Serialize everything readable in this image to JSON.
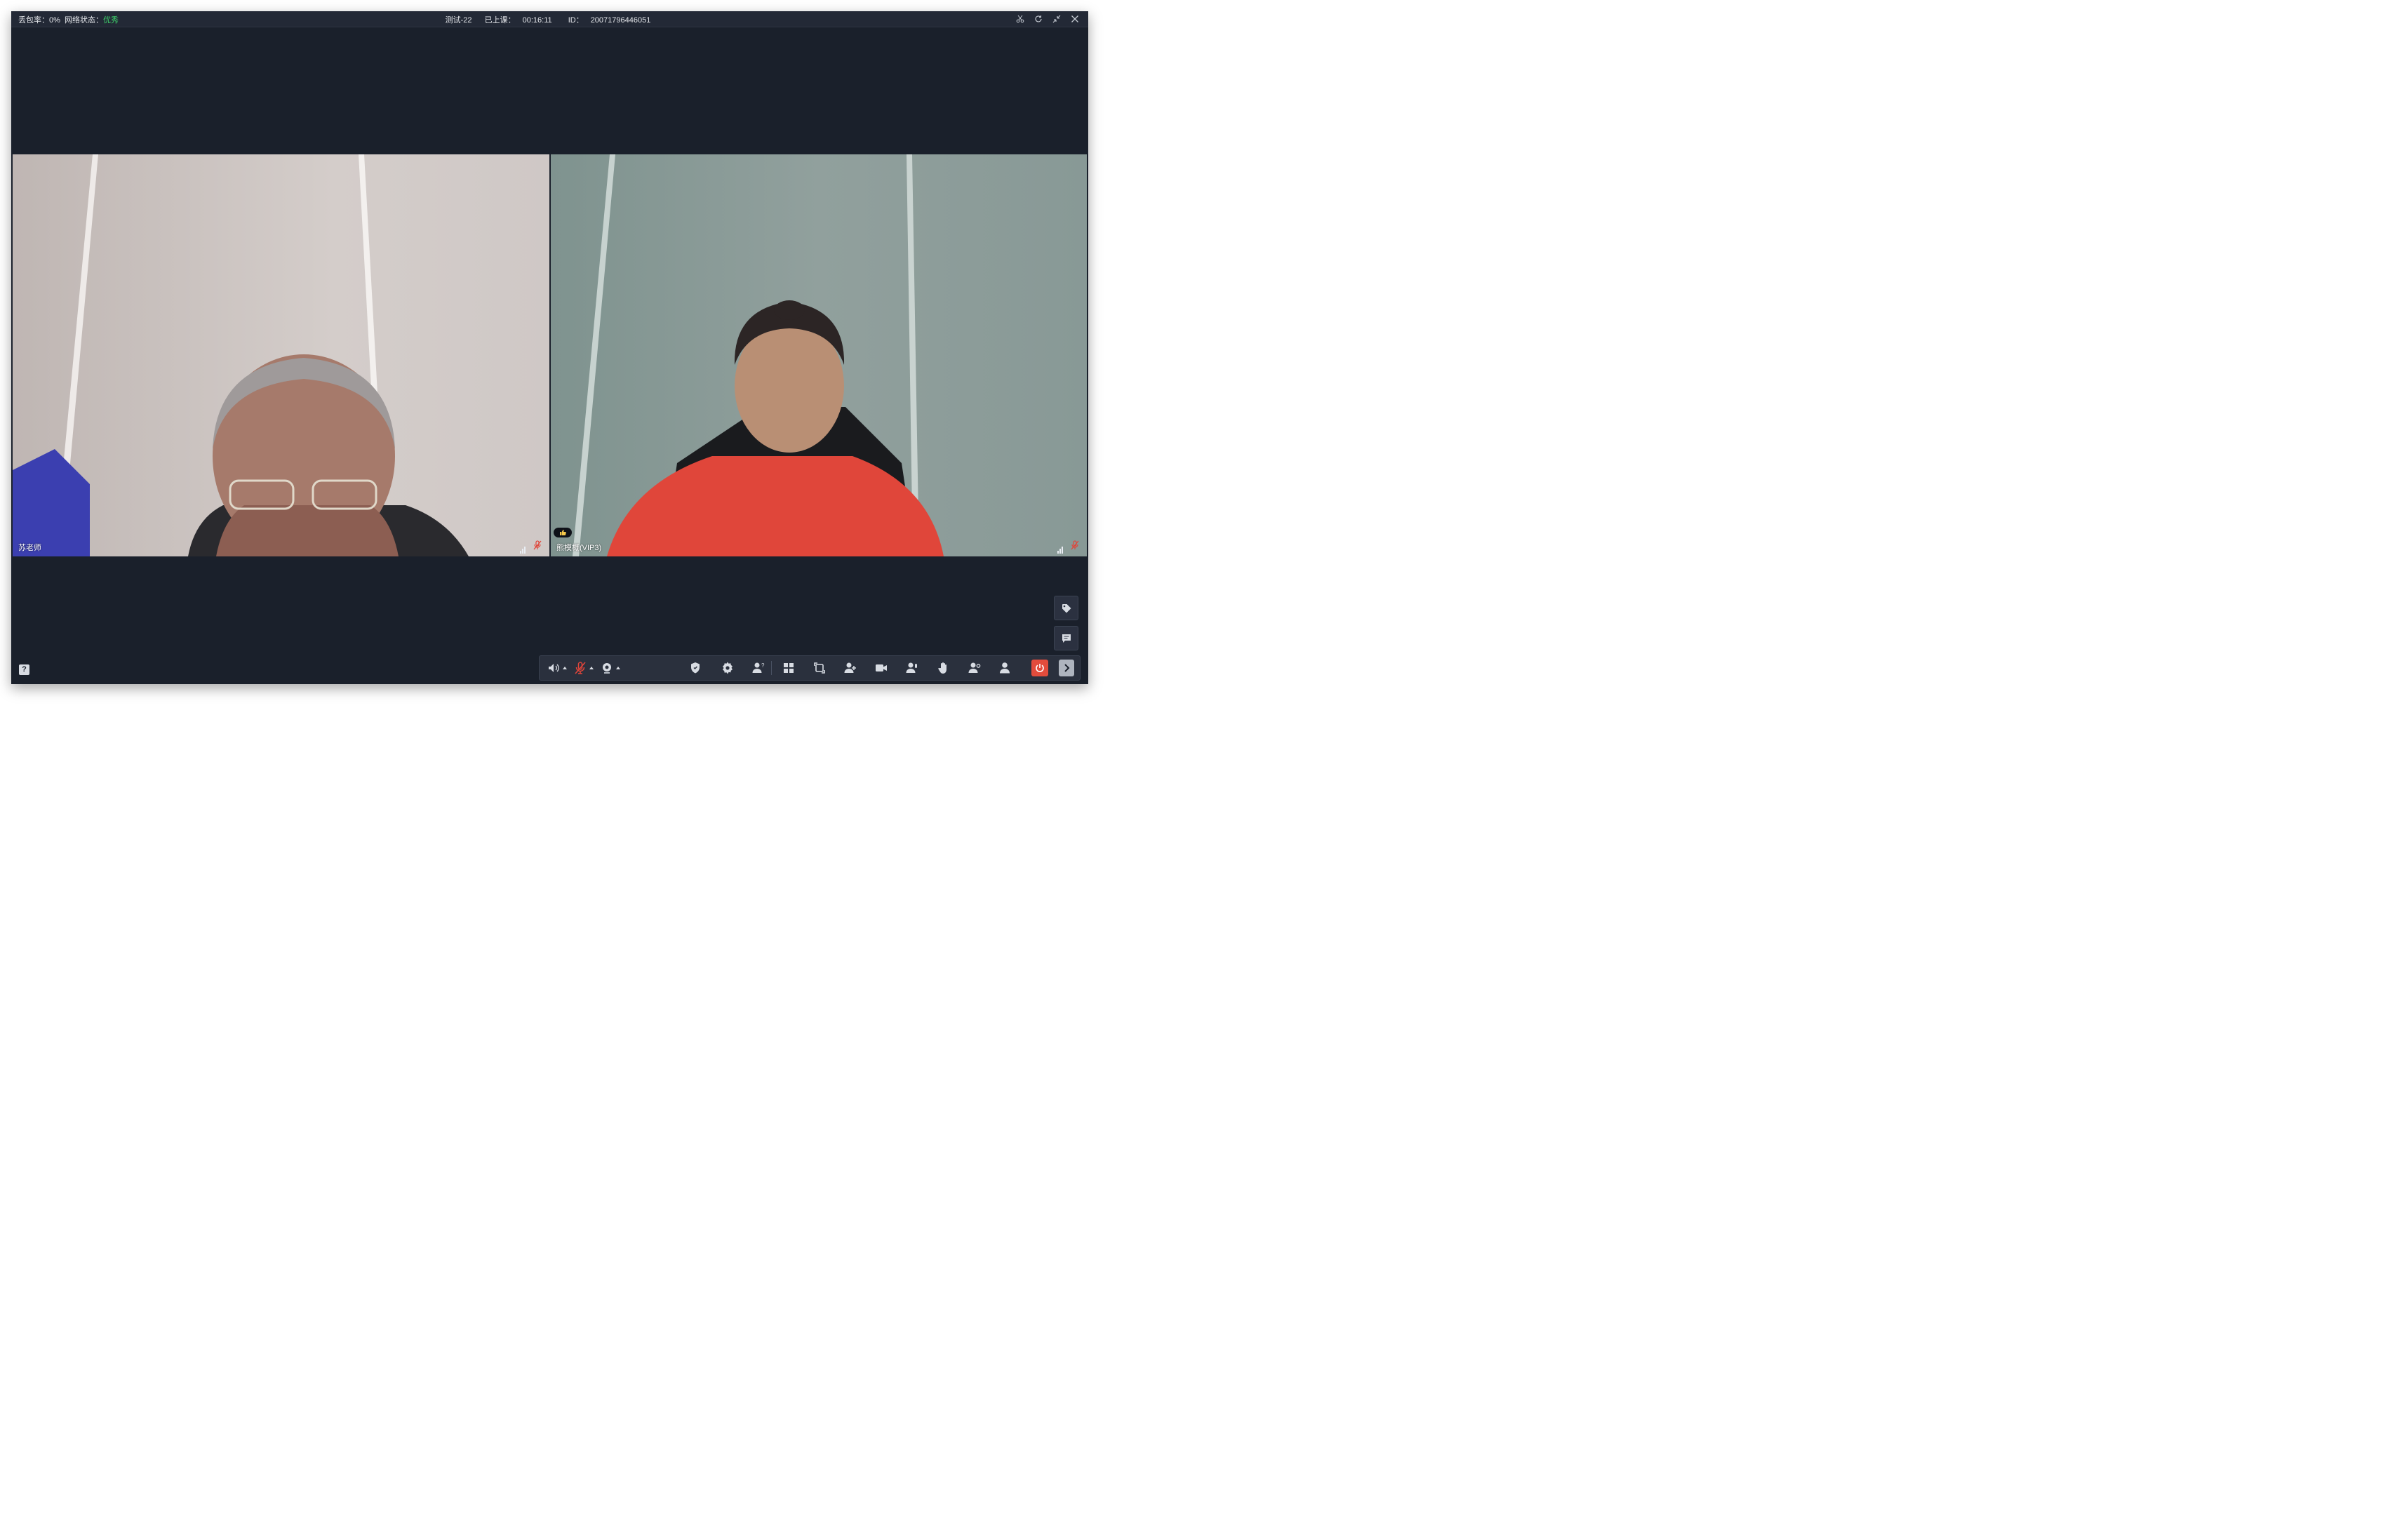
{
  "titlebar": {
    "loss_label": "丢包率：",
    "loss_value": "0%",
    "network_label": "网络状态：",
    "network_value": "优秀",
    "course_name": "测试-22",
    "elapsed_label": "已上课：",
    "elapsed_value": "00:16:11",
    "id_label": "ID：",
    "id_value": "20071796446051",
    "window_buttons": [
      "scissors-icon",
      "refresh-icon",
      "collapse-icon",
      "close-icon"
    ]
  },
  "tiles": [
    {
      "name": "苏老师",
      "signal": "low",
      "mic": "muted"
    },
    {
      "name": "熊模概(VIP3)",
      "signal": "low",
      "mic": "muted",
      "badge": "thumbs-up-icon"
    }
  ],
  "side_buttons": [
    "tag-icon",
    "chat-icon"
  ],
  "help": {
    "label": "?"
  },
  "toolbar": {
    "items": [
      "speaker-icon",
      "mic-muted-icon",
      "camera-icon",
      "shield-user-icon",
      "settings-icon",
      "user-question-icon",
      "grid-layout-icon",
      "switch-icon",
      "add-user-icon",
      "video-icon",
      "user-mic-icon",
      "raise-hand-icon",
      "user-settings-icon",
      "user-icon",
      "power-icon",
      "next-icon"
    ],
    "accent_color": "#e24c3c"
  },
  "colors": {
    "window_bg": "#1a202b",
    "titlebar_bg": "#232936",
    "network_good": "#3fd16b",
    "muted_red": "#e0453a"
  }
}
